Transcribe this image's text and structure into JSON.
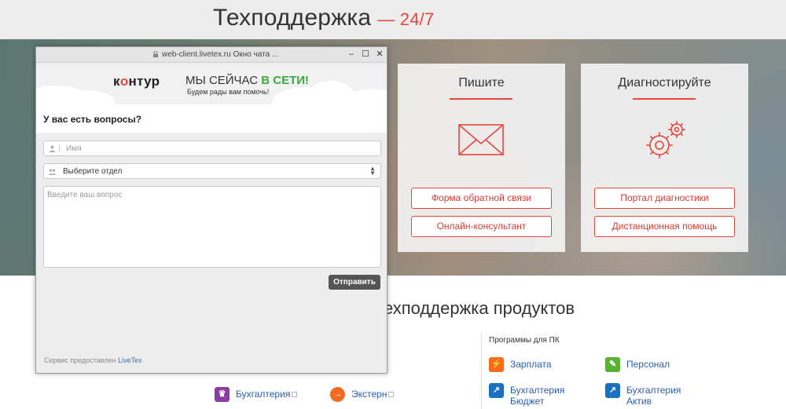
{
  "page": {
    "title": "Техподдержка",
    "title_tag": "— 24/7"
  },
  "cards": {
    "write": {
      "title": "Пишите",
      "button1": "Форма обратной связи",
      "button2": "Онлайн-консультант",
      "icon": "envelope-icon"
    },
    "diagnose": {
      "title": "Диагностируйте",
      "button1": "Портал диагностики",
      "button2": "Дистанционная помощь",
      "icon": "gears-icon"
    }
  },
  "products": {
    "section_title": "ехподдержка продуктов",
    "pc_heading": "Программы для ПК",
    "items": [
      {
        "label": "Зарплата",
        "color": "#f26b21",
        "icon": "zarplata-icon"
      },
      {
        "label": "Персонал",
        "color": "#5ab035",
        "icon": "personal-icon"
      },
      {
        "label": "Бухгалтерия Бюджет",
        "line1": "Бухгалтерия",
        "line2": "Бюджет",
        "color": "#1d6fbf",
        "icon": "budget-icon"
      },
      {
        "label": "Бухгалтерия Актив",
        "line1": "Бухгалтерия",
        "line2": "Актив",
        "color": "#1d6fbf",
        "icon": "aktiv-icon"
      },
      {
        "label": "Бухгалтерия",
        "color": "#8e3aa7",
        "icon": "crown-icon"
      },
      {
        "label": "Экстерн",
        "color": "#f26b21",
        "icon": "extern-icon"
      }
    ]
  },
  "chat": {
    "url": "web-client.livetex.ru  Окно чата ...",
    "brand": {
      "before": "к",
      "o": "o",
      "after": "нтур"
    },
    "online_text": "МЫ СЕЙЧАС",
    "online_highlight": "В СЕТИ!",
    "online_sub": "Будем рады вам помочь!",
    "question": "У вас есть вопросы?",
    "name_placeholder": "Имя",
    "dept_value": "Выберите отдел",
    "message_placeholder": "Введите ваш вопрос",
    "send_label": "Отправить",
    "service_text": "Сервис предоставлен",
    "service_link": "LiveTex",
    "window_buttons": {
      "minimize": "–",
      "maximize": "☐",
      "close": "✕"
    }
  },
  "colors": {
    "accent": "#e8453c",
    "online_green": "#3aa842",
    "link_blue": "#2a5cae"
  }
}
